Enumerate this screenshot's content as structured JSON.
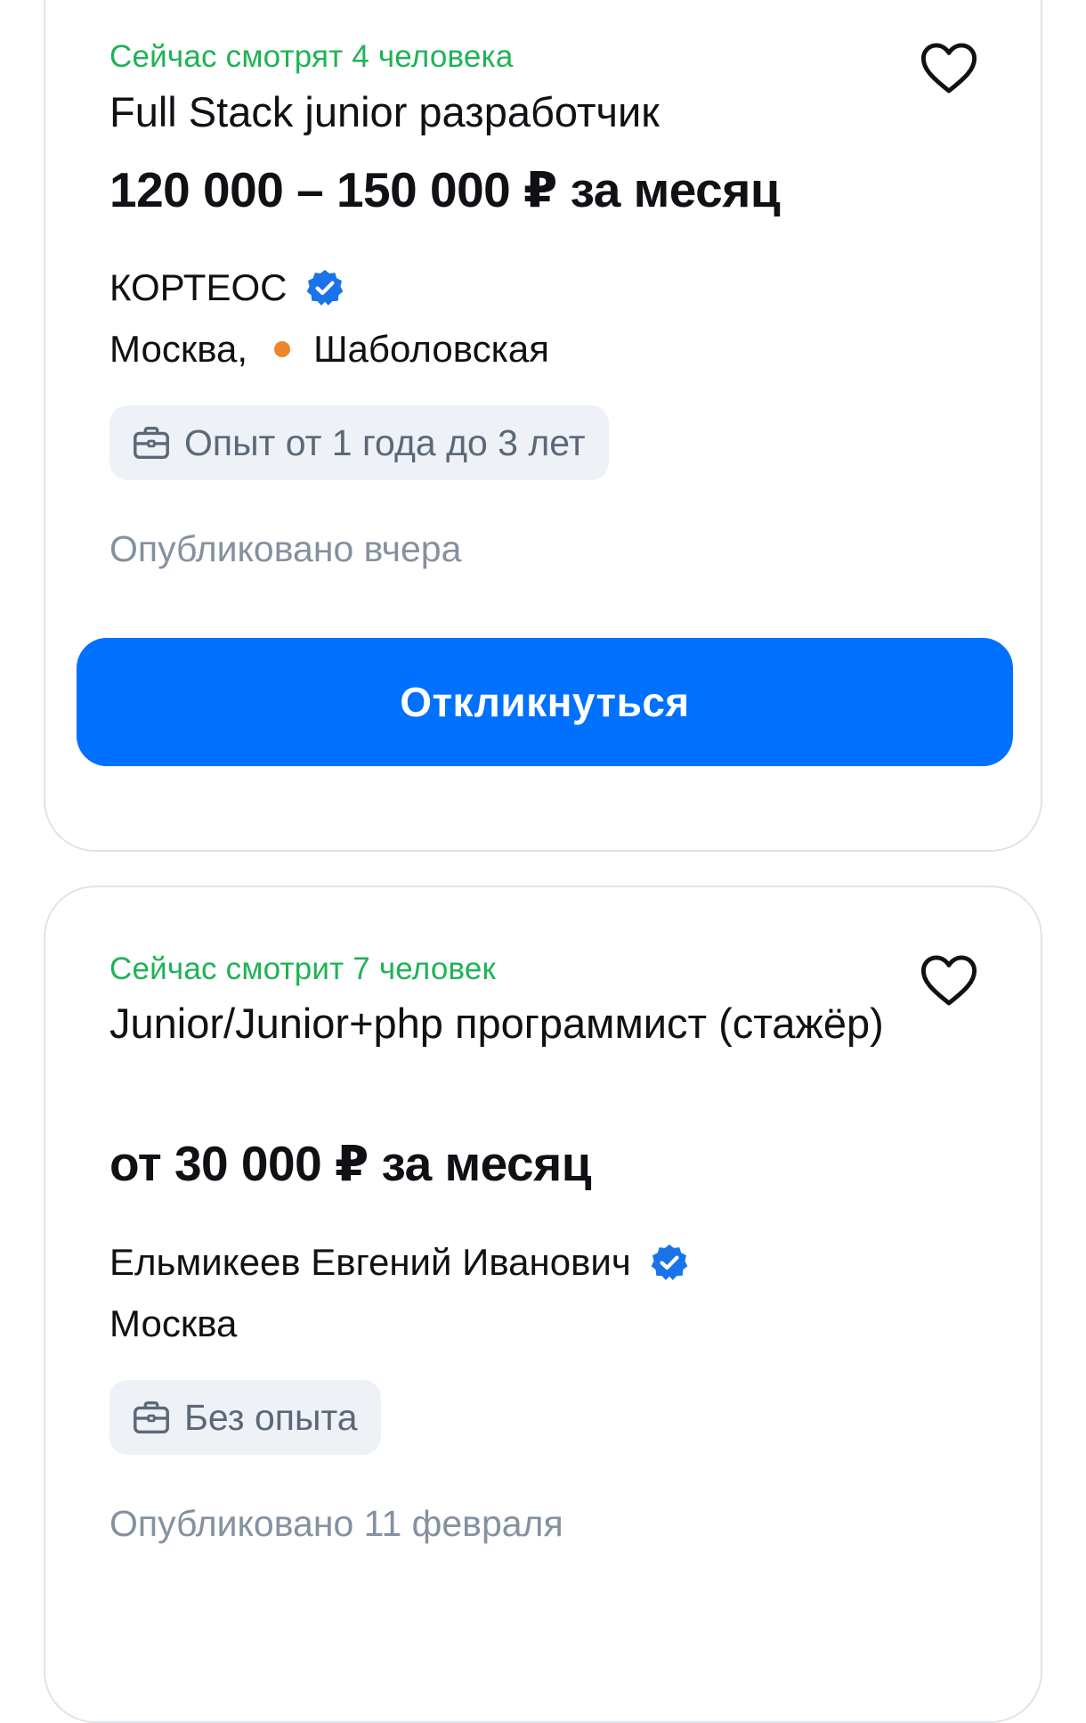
{
  "vacancies": [
    {
      "viewers": "Сейчас смотрят 4 человека",
      "title": "Full Stack junior разработчик",
      "salary": "120 000 – 150 000 ₽ за месяц",
      "company": "КОРТЕОС",
      "city": "Москва,",
      "metro": "Шаболовская",
      "experience": "Опыт от 1 года до 3 лет",
      "published": "Опубликовано вчера",
      "respond_label": "Откликнуться"
    },
    {
      "viewers": "Сейчас смотрит 7 человек",
      "title": "Junior/Junior+php программист (стажёр)",
      "salary": "от 30 000 ₽ за месяц",
      "company": "Ельмикеев Евгений Иванович",
      "city": "Москва",
      "experience": "Без опыта",
      "published": "Опубликовано 11 февраля"
    }
  ],
  "colors": {
    "accent": "#0070ff",
    "viewers_green": "#1fb357",
    "verified_blue": "#1a73e8",
    "metro_orange": "#f0862b",
    "chip_bg": "#eef2f7",
    "muted_text": "#8591a0"
  },
  "icons": {
    "favorite": "heart-outline-icon",
    "verified": "verified-badge-icon",
    "experience": "briefcase-icon",
    "metro": "metro-dot-icon"
  }
}
